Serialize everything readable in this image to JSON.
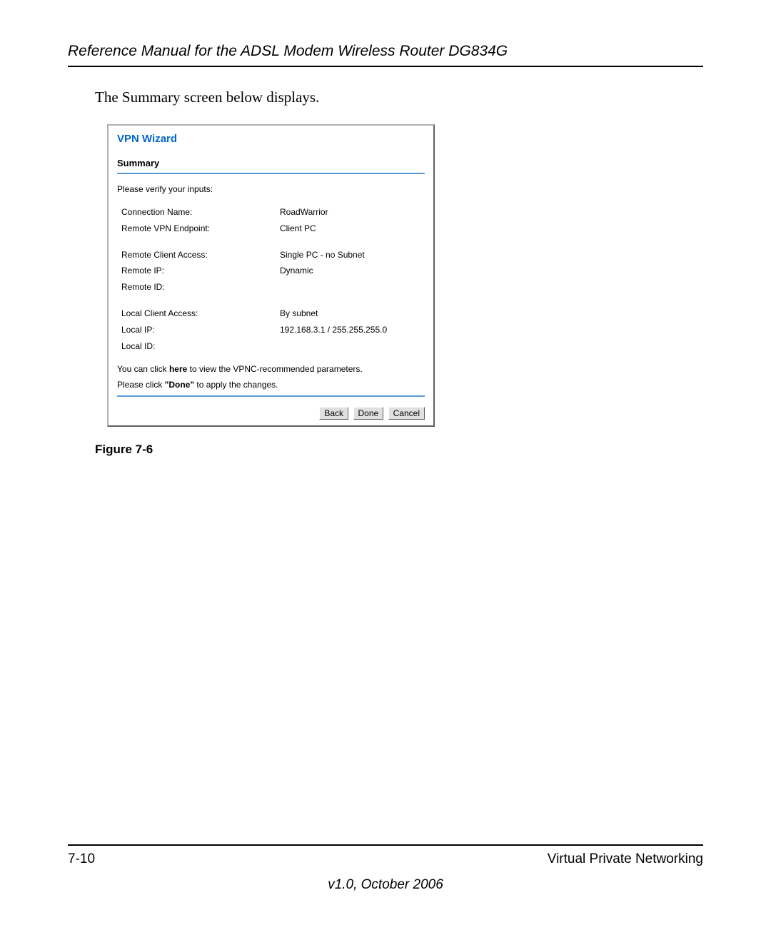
{
  "header": {
    "title": "Reference Manual for the ADSL Modem Wireless Router DG834G"
  },
  "intro": "The Summary screen below displays.",
  "screenshot": {
    "wizard_title": "VPN Wizard",
    "section_title": "Summary",
    "verify_text": "Please verify your inputs:",
    "group1": [
      {
        "label": "Connection Name:",
        "value": "RoadWarrior"
      },
      {
        "label": "Remote VPN Endpoint:",
        "value": "Client PC"
      }
    ],
    "group2": [
      {
        "label": "Remote Client Access:",
        "value": "Single PC - no Subnet"
      },
      {
        "label": "Remote IP:",
        "value": "Dynamic"
      },
      {
        "label": "Remote ID:",
        "value": ""
      }
    ],
    "group3": [
      {
        "label": "Local Client Access:",
        "value": "By subnet"
      },
      {
        "label": "Local IP:",
        "value": "192.168.3.1 / 255.255.255.0"
      },
      {
        "label": "Local ID:",
        "value": ""
      }
    ],
    "hint1_pre": "You can click ",
    "hint1_link": "here",
    "hint1_post": " to view the VPNC-recommended parameters.",
    "hint2_pre": "Please click ",
    "hint2_bold": "\"Done\"",
    "hint2_post": " to apply the changes.",
    "buttons": {
      "back": "Back",
      "done": "Done",
      "cancel": "Cancel"
    }
  },
  "figure_caption": "Figure 7-6",
  "footer": {
    "page_num": "7-10",
    "section_name": "Virtual Private Networking",
    "version": "v1.0, October 2006"
  }
}
